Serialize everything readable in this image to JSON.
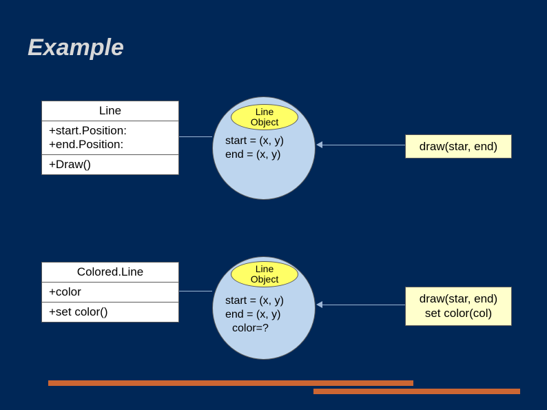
{
  "title": "Example",
  "class1": {
    "name": "Line",
    "attr1": "+start.Position:",
    "attr2": "+end.Position:",
    "method": "+Draw()"
  },
  "class2": {
    "name": "Colored.Line",
    "attr": "+color",
    "method": "+set color()"
  },
  "obj1": {
    "label1": "Line",
    "label2": "Object",
    "line1": "start = (x, y)",
    "line2": "end = (x, y)"
  },
  "obj2": {
    "label1": "Line",
    "label2": "Object",
    "line1": "start = (x, y)",
    "line2": "end = (x, y)",
    "line3": "color=?"
  },
  "res1": "draw(star, end)",
  "res2a": "draw(star, end)",
  "res2b": "set color(col)"
}
